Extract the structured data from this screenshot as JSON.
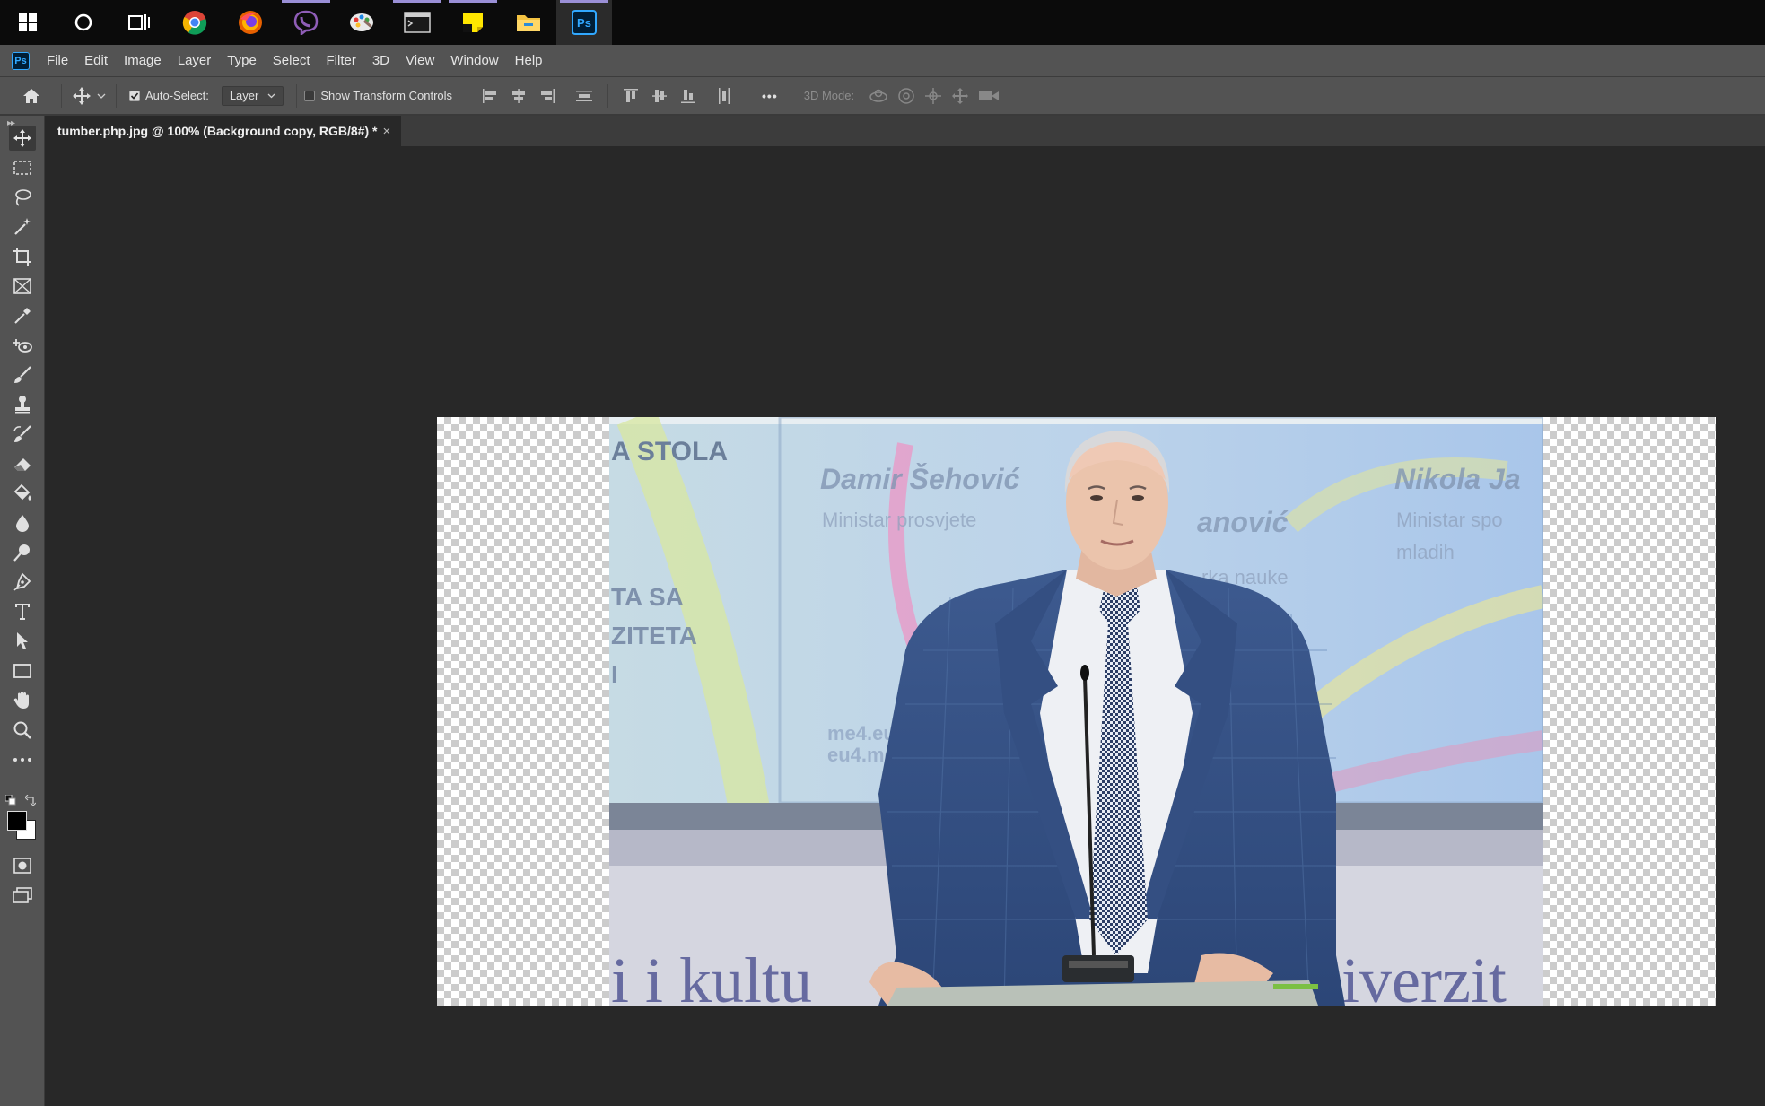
{
  "app": {
    "name": "Photoshop",
    "logo_text": "Ps"
  },
  "taskbar": {
    "items": [
      {
        "icon": "windows-start-icon"
      },
      {
        "icon": "search-circle-icon"
      },
      {
        "icon": "task-view-icon"
      },
      {
        "icon": "chrome-icon"
      },
      {
        "icon": "firefox-icon"
      },
      {
        "icon": "viber-icon"
      },
      {
        "icon": "paint-palette-icon"
      },
      {
        "icon": "terminal-window-icon"
      },
      {
        "icon": "sticky-notes-icon"
      },
      {
        "icon": "file-explorer-icon"
      },
      {
        "icon": "photoshop-icon",
        "label": "Ps",
        "active": true
      }
    ]
  },
  "menu": {
    "items": [
      "File",
      "Edit",
      "Image",
      "Layer",
      "Type",
      "Select",
      "Filter",
      "3D",
      "View",
      "Window",
      "Help"
    ]
  },
  "options": {
    "auto_select_label": "Auto-Select:",
    "auto_select_checked": true,
    "auto_select_target": "Layer",
    "show_transform_label": "Show Transform Controls",
    "show_transform_checked": false,
    "mode_3d_label": "3D Mode:",
    "more_label": "•••"
  },
  "document": {
    "tab_title": "tumber.php.jpg @ 100% (Background copy, RGB/8#) *",
    "close_glyph": "×"
  },
  "photo_text": {
    "stola": "A STOLA",
    "name_left": "Damir Šehović",
    "role_left": "Ministar prosvjete",
    "name_right": "Nikola Ja",
    "role_right_1": "Ministar spo",
    "role_right_2": "mladih",
    "mid_name": "anović",
    "mid_role": "rka nauke",
    "sa": "TA SA",
    "ziteta": "ZITETA",
    "i_letter": "I",
    "me4_1": "me4.eu",
    "me4_2": "eu4.me",
    "bottom_banner": "i i kultu",
    "bottom_banner_right": "niverzit"
  },
  "colors": {
    "accent": "#31a8ff",
    "taskbar_running": "#9a8fd6",
    "panel": "#535353",
    "workspace": "#282828"
  }
}
